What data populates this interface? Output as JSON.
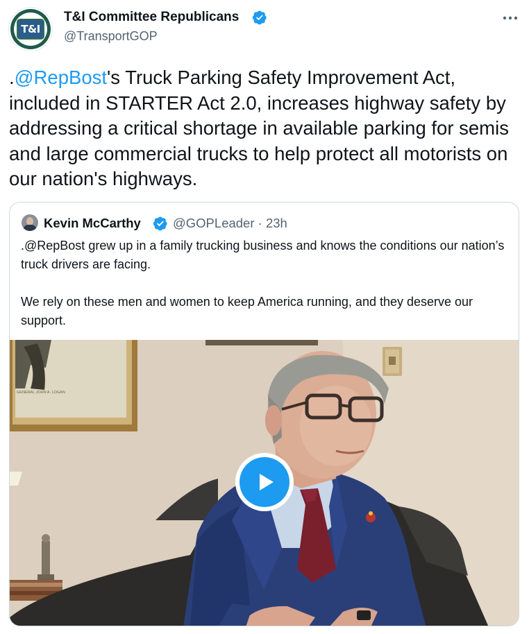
{
  "author": {
    "avatar_text": "T&I",
    "display_name": "T&I Committee Republicans",
    "handle": "@TransportGOP"
  },
  "more_icon": "more-horizontal-icon",
  "tweet": {
    "prefix": ".",
    "mention": "@RepBost",
    "text": "'s Truck Parking Safety Improvement Act, included in STARTER Act 2.0, increases highway safety by addressing a critical shortage in available parking for semis and large commercial trucks to help protect all motorists on our nation's highways."
  },
  "quote": {
    "display_name": "Kevin McCarthy",
    "handle": "@GOPLeader",
    "separator": "·",
    "time": "23h",
    "paragraph_1": ".@RepBost grew up in a family trucking business and knows the conditions our nation’s truck drivers are facing.",
    "paragraph_2": "We rely on these men and women to keep America running, and they deserve our support.",
    "video": {
      "frame_caption": "GENERAL JOHN A. LOGAN",
      "play_icon": "play-icon"
    }
  },
  "colors": {
    "accent": "#1d9bf0",
    "text": "#0f1419",
    "secondary": "#536471",
    "border": "#cfd9de"
  }
}
